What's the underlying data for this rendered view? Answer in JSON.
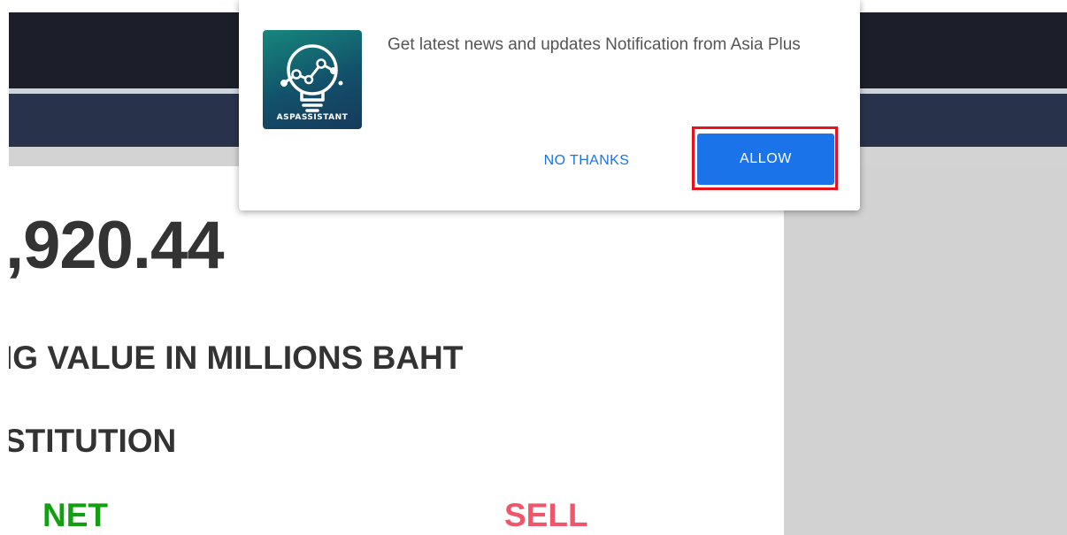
{
  "notification": {
    "app_icon_label": "ASPASSISTANT",
    "message": "Get latest news and updates Notification from Asia Plus",
    "no_thanks_label": "NO THANKS",
    "allow_label": "ALLOW"
  },
  "page": {
    "index_value": ",920.44",
    "trading_heading": "IG VALUE IN MILLIONS BAHT",
    "institution_heading": "STITUTION",
    "net_label": "NET",
    "sell_label": "SELL"
  },
  "colors": {
    "header_dark": "#1c1f29",
    "nav_bar": "#28324a",
    "side_panel": "#d2d2d2",
    "net_green": "#12a012",
    "sell_red": "#f0566a",
    "allow_blue": "#1a73e8",
    "highlight_red": "#e8121b"
  },
  "icons": {
    "app_icon": "lightbulb-chart-icon"
  }
}
